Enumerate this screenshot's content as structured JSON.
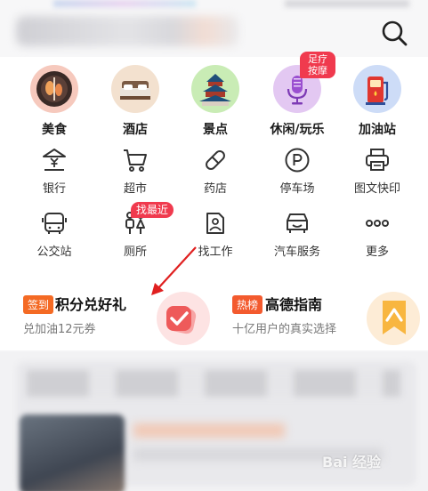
{
  "categories": [
    {
      "label": "美食",
      "icon": "food-icon"
    },
    {
      "label": "酒店",
      "icon": "hotel-icon"
    },
    {
      "label": "景点",
      "icon": "attraction-icon"
    },
    {
      "label": "休闲/玩乐",
      "icon": "leisure-icon",
      "badge": "足疗按摩"
    },
    {
      "label": "加油站",
      "icon": "gas-station-icon"
    }
  ],
  "services_row1": [
    {
      "label": "银行",
      "icon": "bank-icon"
    },
    {
      "label": "超市",
      "icon": "cart-icon"
    },
    {
      "label": "药店",
      "icon": "pill-icon"
    },
    {
      "label": "停车场",
      "icon": "parking-icon"
    },
    {
      "label": "图文快印",
      "icon": "printer-icon"
    }
  ],
  "services_row2": [
    {
      "label": "公交站",
      "icon": "bus-icon"
    },
    {
      "label": "厕所",
      "icon": "toilet-icon",
      "badge": "找最近"
    },
    {
      "label": "找工作",
      "icon": "job-icon"
    },
    {
      "label": "汽车服务",
      "icon": "car-service-icon"
    },
    {
      "label": "更多",
      "icon": "more-icon"
    }
  ],
  "cards": {
    "points": {
      "tag": "签到",
      "title": "积分兑好礼",
      "subtitle": "兑加油12元券"
    },
    "ranking": {
      "tag": "热榜",
      "title": "高德指南",
      "subtitle": "十亿用户的真实选择"
    }
  },
  "watermark": "Bai 经验",
  "colors": {
    "accent": "#f03a4e",
    "tag_orange": "#f46a24",
    "tag_red": "#f35a2e"
  }
}
